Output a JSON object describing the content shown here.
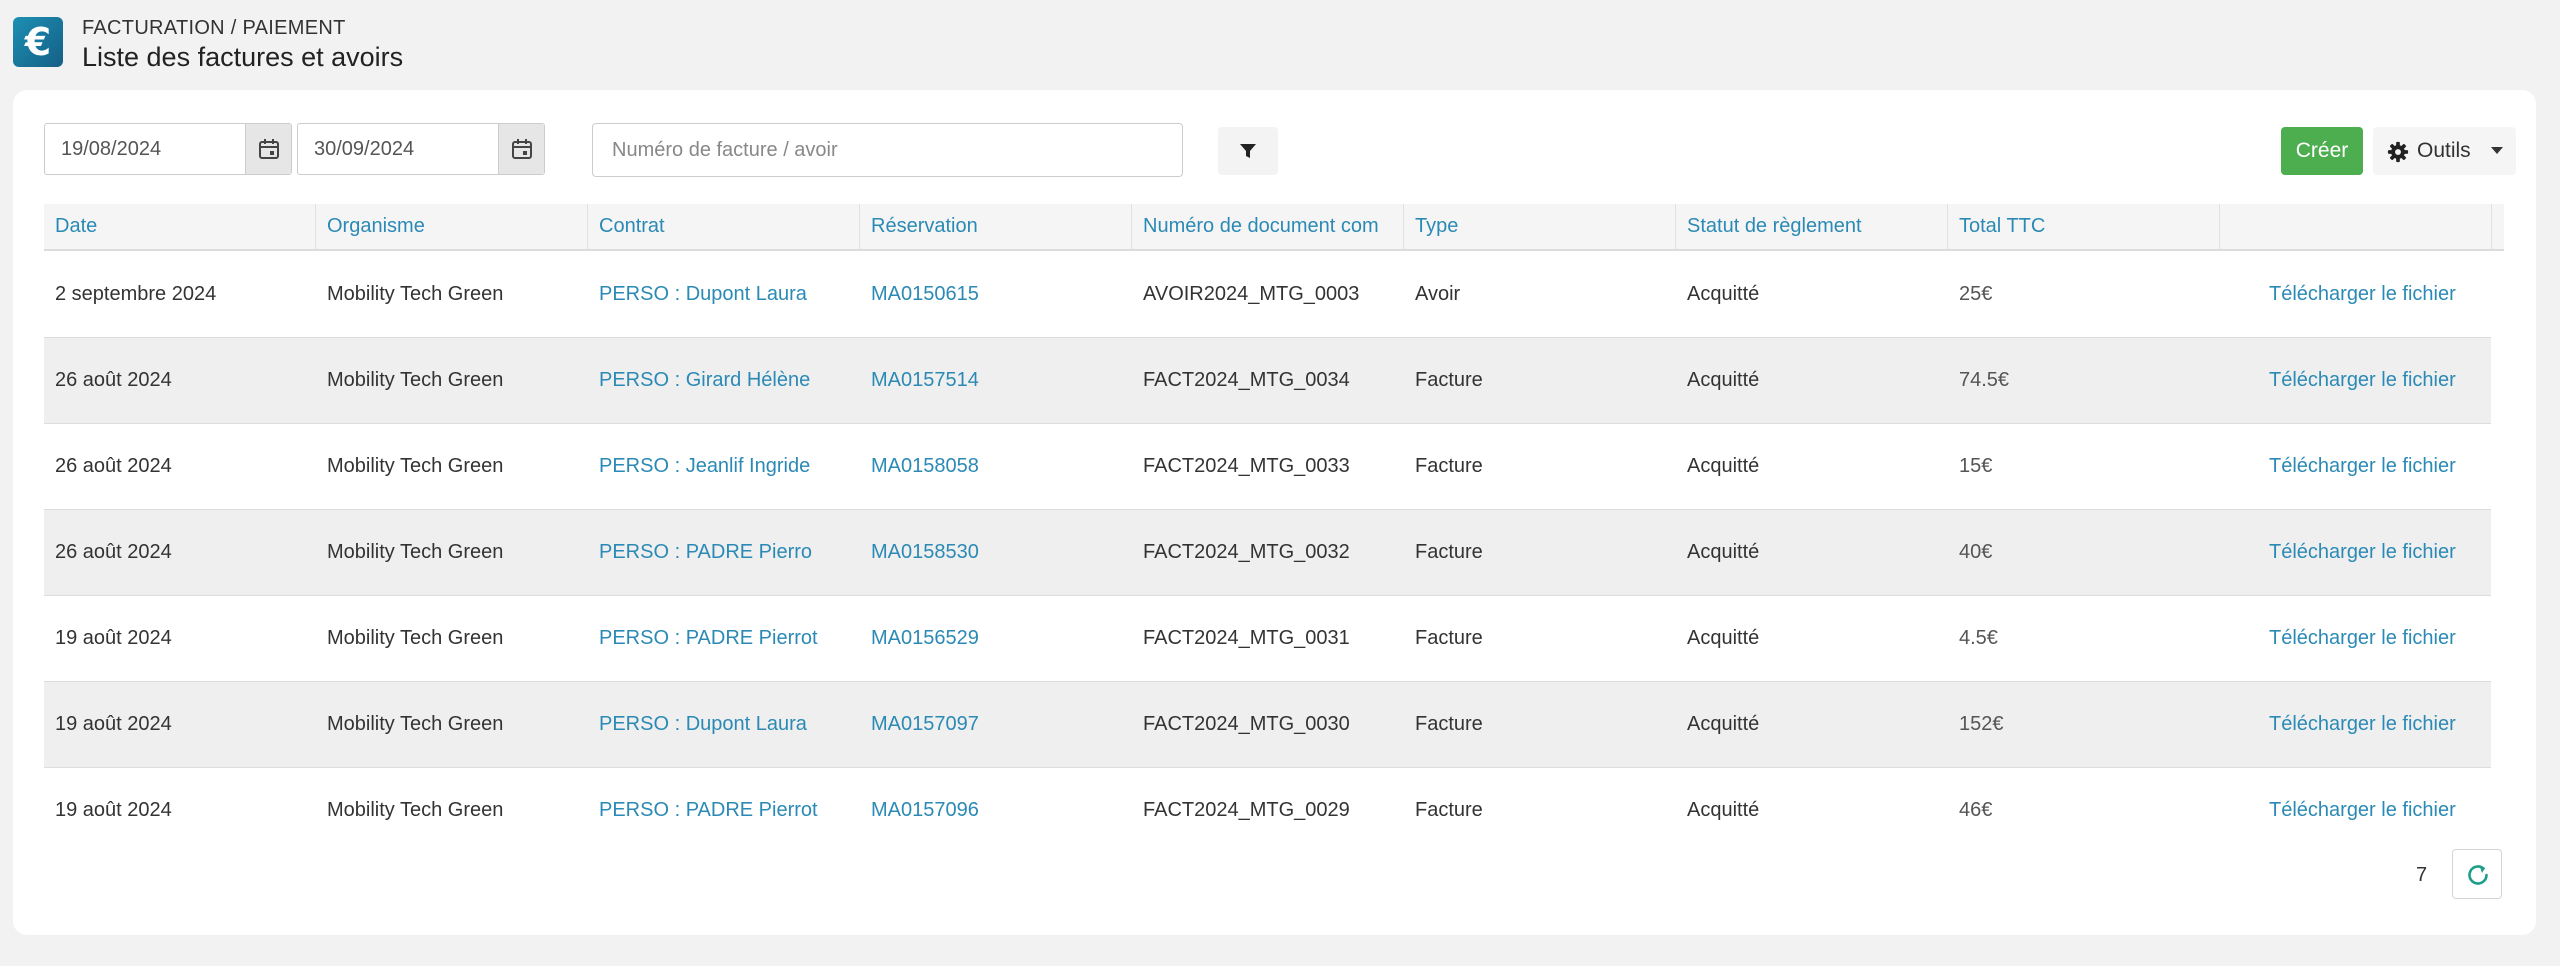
{
  "header": {
    "icon_glyph": "€",
    "breadcrumb": "FACTURATION / PAIEMENT",
    "title": "Liste des factures et avoirs"
  },
  "filters": {
    "date_start": "19/08/2024",
    "date_end": "30/09/2024",
    "search_placeholder": "Numéro de facture / avoir",
    "search_value": ""
  },
  "toolbar": {
    "create_label": "Créer",
    "tools_label": "Outils"
  },
  "table": {
    "columns": [
      "Date",
      "Organisme",
      "Contrat",
      "Réservation",
      "Numéro de document com",
      "Type",
      "Statut de règlement",
      "Total TTC",
      ""
    ],
    "rows": [
      {
        "date": "2 septembre 2024",
        "organisme": "Mobility Tech Green",
        "contrat": "PERSO : Dupont Laura",
        "reservation": "MA0150615",
        "numero": "AVOIR2024_MTG_0003",
        "type": "Avoir",
        "statut": "Acquitté",
        "total": "25€",
        "action": "Télécharger le fichier"
      },
      {
        "date": "26 août 2024",
        "organisme": "Mobility Tech Green",
        "contrat": "PERSO : Girard Hélène",
        "reservation": "MA0157514",
        "numero": "FACT2024_MTG_0034",
        "type": "Facture",
        "statut": "Acquitté",
        "total": "74.5€",
        "action": "Télécharger le fichier"
      },
      {
        "date": "26 août 2024",
        "organisme": "Mobility Tech Green",
        "contrat": "PERSO : Jeanlif Ingride",
        "reservation": "MA0158058",
        "numero": "FACT2024_MTG_0033",
        "type": "Facture",
        "statut": "Acquitté",
        "total": "15€",
        "action": "Télécharger le fichier"
      },
      {
        "date": "26 août 2024",
        "organisme": "Mobility Tech Green",
        "contrat": "PERSO : PADRE Pierro",
        "reservation": "MA0158530",
        "numero": "FACT2024_MTG_0032",
        "type": "Facture",
        "statut": "Acquitté",
        "total": "40€",
        "action": "Télécharger le fichier"
      },
      {
        "date": "19 août 2024",
        "organisme": "Mobility Tech Green",
        "contrat": "PERSO : PADRE Pierrot",
        "reservation": "MA0156529",
        "numero": "FACT2024_MTG_0031",
        "type": "Facture",
        "statut": "Acquitté",
        "total": "4.5€",
        "action": "Télécharger le fichier"
      },
      {
        "date": "19 août 2024",
        "organisme": "Mobility Tech Green",
        "contrat": "PERSO : Dupont Laura",
        "reservation": "MA0157097",
        "numero": "FACT2024_MTG_0030",
        "type": "Facture",
        "statut": "Acquitté",
        "total": "152€",
        "action": "Télécharger le fichier"
      },
      {
        "date": "19 août 2024",
        "organisme": "Mobility Tech Green",
        "contrat": "PERSO : PADRE Pierrot",
        "reservation": "MA0157096",
        "numero": "FACT2024_MTG_0029",
        "type": "Facture",
        "statut": "Acquitté",
        "total": "46€",
        "action": "Télécharger le fichier"
      }
    ]
  },
  "footer": {
    "count": "7"
  },
  "icons": {
    "header": "euro-icon",
    "calendar": "calendar-icon",
    "filter": "filter-icon",
    "tools": "gear-icon",
    "tools_caret": "caret-down-icon",
    "refresh": "refresh-icon"
  },
  "colors": {
    "accent": "#2b8ab5",
    "create_button": "#4cae4f",
    "header_icon": "#1a7ca5",
    "row_alt": "#efefef"
  }
}
